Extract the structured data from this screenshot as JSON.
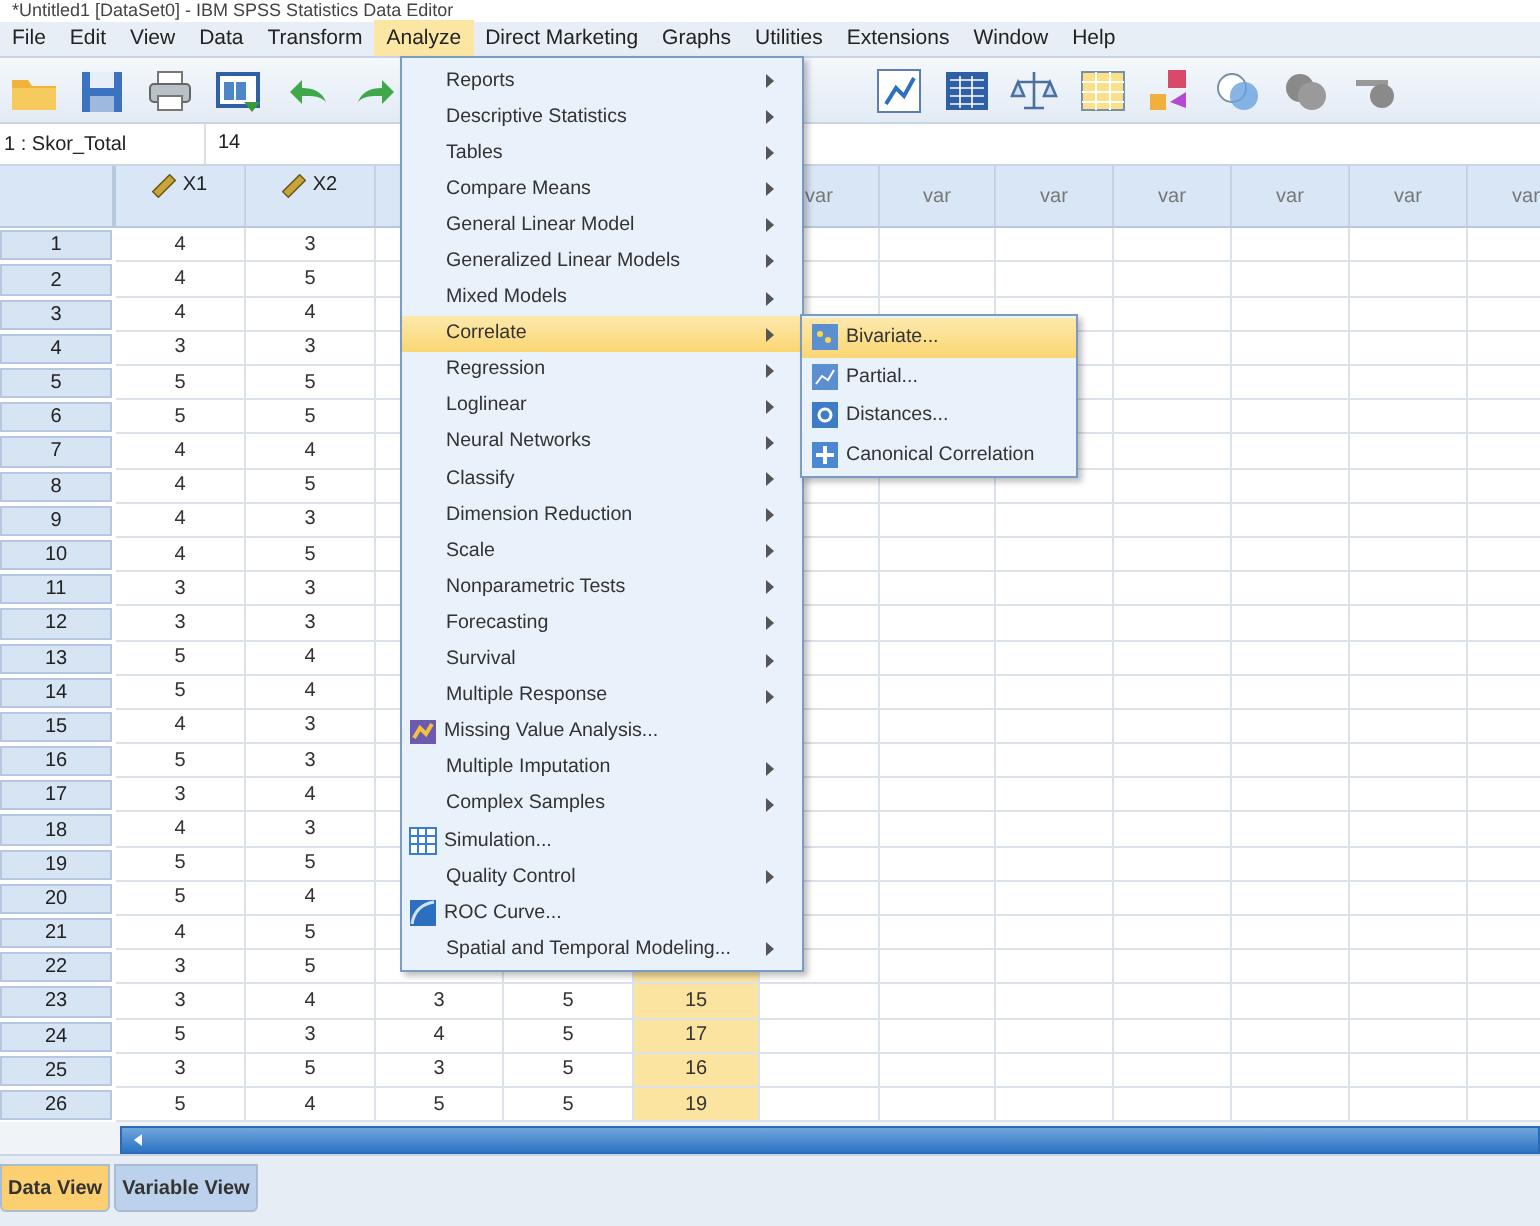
{
  "window": {
    "title": "*Untitled1 [DataSet0] - IBM SPSS Statistics Data Editor"
  },
  "menu_bar": [
    {
      "label": "File",
      "selected": false
    },
    {
      "label": "Edit",
      "selected": false
    },
    {
      "label": "View",
      "selected": false
    },
    {
      "label": "Data",
      "selected": false
    },
    {
      "label": "Transform",
      "selected": false
    },
    {
      "label": "Analyze",
      "selected": true
    },
    {
      "label": "Direct Marketing",
      "selected": false
    },
    {
      "label": "Graphs",
      "selected": false
    },
    {
      "label": "Utilities",
      "selected": false
    },
    {
      "label": "Extensions",
      "selected": false
    },
    {
      "label": "Window",
      "selected": false
    },
    {
      "label": "Help",
      "selected": false
    }
  ],
  "cell_editor": {
    "cell": "1 : Skor_Total",
    "value": "14"
  },
  "columns": [
    {
      "kind": "variable",
      "label": "X1",
      "selected": false
    },
    {
      "kind": "variable",
      "label": "X2",
      "selected": false
    },
    {
      "kind": "clipped",
      "selected": false
    },
    {
      "kind": "covered",
      "selected": false
    },
    {
      "kind": "covered",
      "selected": true
    },
    {
      "kind": "empty",
      "label": "var",
      "selected": false
    },
    {
      "kind": "empty",
      "label": "var",
      "selected": false
    },
    {
      "kind": "empty",
      "label": "var",
      "selected": false
    },
    {
      "kind": "empty",
      "label": "var",
      "selected": false
    },
    {
      "kind": "empty",
      "label": "var",
      "selected": false
    },
    {
      "kind": "empty",
      "label": "var",
      "selected": false
    },
    {
      "kind": "empty",
      "label": "var",
      "selected": false
    }
  ],
  "rows": [
    {
      "num": "1",
      "cells": [
        "4",
        "3"
      ]
    },
    {
      "num": "2",
      "cells": [
        "4",
        "5"
      ]
    },
    {
      "num": "3",
      "cells": [
        "4",
        "4"
      ]
    },
    {
      "num": "4",
      "cells": [
        "3",
        "3"
      ]
    },
    {
      "num": "5",
      "cells": [
        "5",
        "5"
      ]
    },
    {
      "num": "6",
      "cells": [
        "5",
        "5"
      ]
    },
    {
      "num": "7",
      "cells": [
        "4",
        "4"
      ]
    },
    {
      "num": "8",
      "cells": [
        "4",
        "5"
      ]
    },
    {
      "num": "9",
      "cells": [
        "4",
        "3"
      ]
    },
    {
      "num": "10",
      "cells": [
        "4",
        "5"
      ]
    },
    {
      "num": "11",
      "cells": [
        "3",
        "3"
      ]
    },
    {
      "num": "12",
      "cells": [
        "3",
        "3"
      ]
    },
    {
      "num": "13",
      "cells": [
        "5",
        "4"
      ]
    },
    {
      "num": "14",
      "cells": [
        "5",
        "4"
      ]
    },
    {
      "num": "15",
      "cells": [
        "4",
        "3"
      ]
    },
    {
      "num": "16",
      "cells": [
        "5",
        "3"
      ]
    },
    {
      "num": "17",
      "cells": [
        "3",
        "4"
      ]
    },
    {
      "num": "18",
      "cells": [
        "4",
        "3"
      ]
    },
    {
      "num": "19",
      "cells": [
        "5",
        "5"
      ]
    },
    {
      "num": "20",
      "cells": [
        "5",
        "4"
      ]
    },
    {
      "num": "21",
      "cells": [
        "4",
        "5"
      ]
    },
    {
      "num": "22",
      "cells": [
        "3",
        "5"
      ]
    },
    {
      "num": "23",
      "cells": [
        "3",
        "4",
        "3",
        "5",
        "15"
      ]
    },
    {
      "num": "24",
      "cells": [
        "5",
        "3",
        "4",
        "5",
        "17"
      ]
    },
    {
      "num": "25",
      "cells": [
        "3",
        "5",
        "3",
        "5",
        "16"
      ]
    },
    {
      "num": "26",
      "cells": [
        "5",
        "4",
        "5",
        "5",
        "19"
      ]
    }
  ],
  "analyze_menu": [
    {
      "label": "Reports",
      "kind": "submenu",
      "selected": false
    },
    {
      "label": "Descriptive Statistics",
      "kind": "submenu",
      "selected": false
    },
    {
      "label": "Tables",
      "kind": "submenu",
      "selected": false
    },
    {
      "label": "Compare Means",
      "kind": "submenu",
      "selected": false
    },
    {
      "label": "General Linear Model",
      "kind": "submenu",
      "selected": false
    },
    {
      "label": "Generalized Linear Models",
      "kind": "submenu",
      "selected": false
    },
    {
      "label": "Mixed Models",
      "kind": "submenu",
      "selected": false
    },
    {
      "label": "Correlate",
      "kind": "submenu",
      "selected": true
    },
    {
      "label": "Regression",
      "kind": "submenu",
      "selected": false
    },
    {
      "label": "Loglinear",
      "kind": "submenu",
      "selected": false
    },
    {
      "label": "Neural Networks",
      "kind": "submenu",
      "selected": false
    },
    {
      "label": "Classify",
      "kind": "submenu",
      "selected": false
    },
    {
      "label": "Dimension Reduction",
      "kind": "submenu",
      "selected": false
    },
    {
      "label": "Scale",
      "kind": "submenu",
      "selected": false
    },
    {
      "label": "Nonparametric Tests",
      "kind": "submenu",
      "selected": false
    },
    {
      "label": "Forecasting",
      "kind": "submenu",
      "selected": false
    },
    {
      "label": "Survival",
      "kind": "submenu",
      "selected": false
    },
    {
      "label": "Multiple Response",
      "kind": "submenu",
      "selected": false
    },
    {
      "label": "Missing Value Analysis...",
      "kind": "dialog",
      "selected": false
    },
    {
      "label": "Multiple Imputation",
      "kind": "submenu",
      "selected": false
    },
    {
      "label": "Complex Samples",
      "kind": "submenu",
      "selected": false
    },
    {
      "label": "Simulation...",
      "kind": "dialog",
      "selected": false
    },
    {
      "label": "Quality Control",
      "kind": "submenu",
      "selected": false
    },
    {
      "label": "ROC Curve...",
      "kind": "dialog",
      "selected": false
    },
    {
      "label": "Spatial and Temporal Modeling...",
      "kind": "submenu",
      "selected": false
    }
  ],
  "correlate_submenu": [
    {
      "label": "Bivariate...",
      "selected": true
    },
    {
      "label": "Partial...",
      "selected": false
    },
    {
      "label": "Distances...",
      "selected": false
    },
    {
      "label": "Canonical Correlation",
      "selected": false
    }
  ],
  "view_tabs": [
    {
      "label": "Data View",
      "selected": true
    },
    {
      "label": "Variable View",
      "selected": false
    }
  ]
}
